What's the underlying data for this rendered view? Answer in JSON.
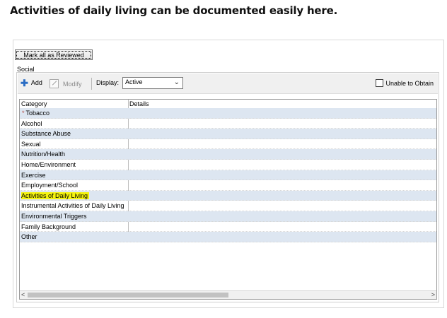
{
  "caption": "Activities of daily living can be documented easily here.",
  "mark_reviewed_label": "Mark all as Reviewed",
  "group_title": "Social",
  "toolbar": {
    "add_label": "Add",
    "modify_label": "Modify",
    "display_label": "Display:",
    "display_value": "Active",
    "unable_label": "Unable to Obtain"
  },
  "grid": {
    "columns": [
      "Category",
      "Details"
    ],
    "rows": [
      {
        "category": "Tobacco",
        "details": ""
      },
      {
        "category": "Alcohol",
        "details": ""
      },
      {
        "category": "Substance Abuse",
        "details": ""
      },
      {
        "category": "Sexual",
        "details": ""
      },
      {
        "category": "Nutrition/Health",
        "details": ""
      },
      {
        "category": "Home/Environment",
        "details": ""
      },
      {
        "category": "Exercise",
        "details": ""
      },
      {
        "category": "Employment/School",
        "details": ""
      },
      {
        "category": "Activities of Daily Living",
        "details": ""
      },
      {
        "category": "Instrumental Activities of Daily Living",
        "details": ""
      },
      {
        "category": "Environmental Triggers",
        "details": ""
      },
      {
        "category": "Family Background",
        "details": ""
      },
      {
        "category": "Other",
        "details": ""
      }
    ]
  },
  "colors": {
    "row_alt": "#dde6f1",
    "highlight": "#f4f30f",
    "accent_plus": "#2a6dc4"
  },
  "icons": [
    "plus-icon",
    "modify-icon",
    "chevron-down-icon",
    "star-icon",
    "chevron-left-icon",
    "chevron-right-icon"
  ]
}
